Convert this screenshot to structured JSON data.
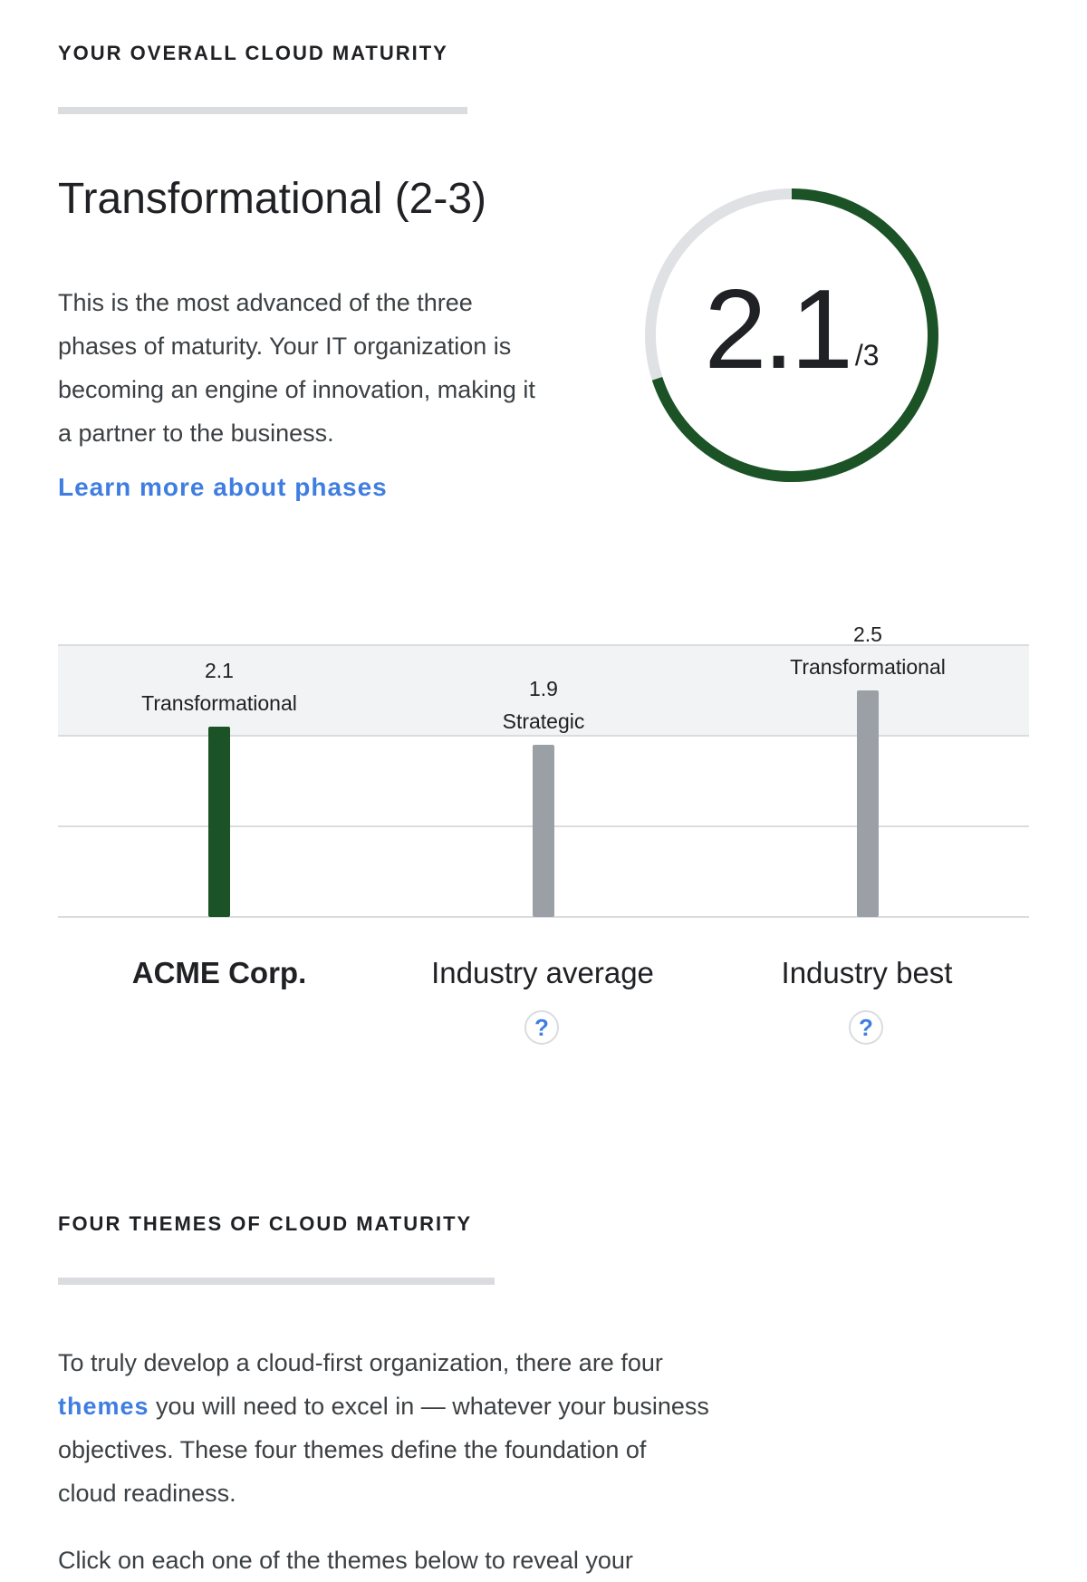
{
  "section_overall": {
    "heading": "YOUR OVERALL CLOUD MATURITY",
    "phase_title": "Transformational (2-3)",
    "description": "This is the most advanced of the three phases of maturity. Your IT organization is becoming an engine of innovation, making it a partner to the business.",
    "learn_more_link": "Learn more about phases"
  },
  "score_gauge": {
    "score": "2.1",
    "max_label": "/3",
    "value": 2.1,
    "max": 3,
    "colors": {
      "fill": "#1b5226",
      "track": "#dfe1e5"
    }
  },
  "chart_data": {
    "type": "bar",
    "categories": [
      "ACME Corp.",
      "Industry average",
      "Industry best"
    ],
    "values": [
      2.1,
      1.9,
      2.5
    ],
    "phase_labels": [
      "Transformational",
      "Strategic",
      "Transformational"
    ],
    "ylim": [
      0,
      3
    ],
    "grid": true,
    "highlight_band": [
      2,
      3
    ],
    "colors": {
      "highlight": "#1b5226",
      "default": "#9aa0a6",
      "band": "#f1f3f4",
      "grid": "#dadce0"
    },
    "help_icons": [
      "question-icon",
      "question-icon"
    ]
  },
  "section_themes": {
    "heading": "FOUR THEMES OF CLOUD MATURITY",
    "intro_before_link": "To truly develop a cloud-first organization, there are four ",
    "intro_link": "themes",
    "intro_after_link": " you will need to excel in — whatever your business objectives. These four themes define the foundation of cloud readiness.",
    "click_note": "Click on each one of the themes below to reveal your"
  }
}
